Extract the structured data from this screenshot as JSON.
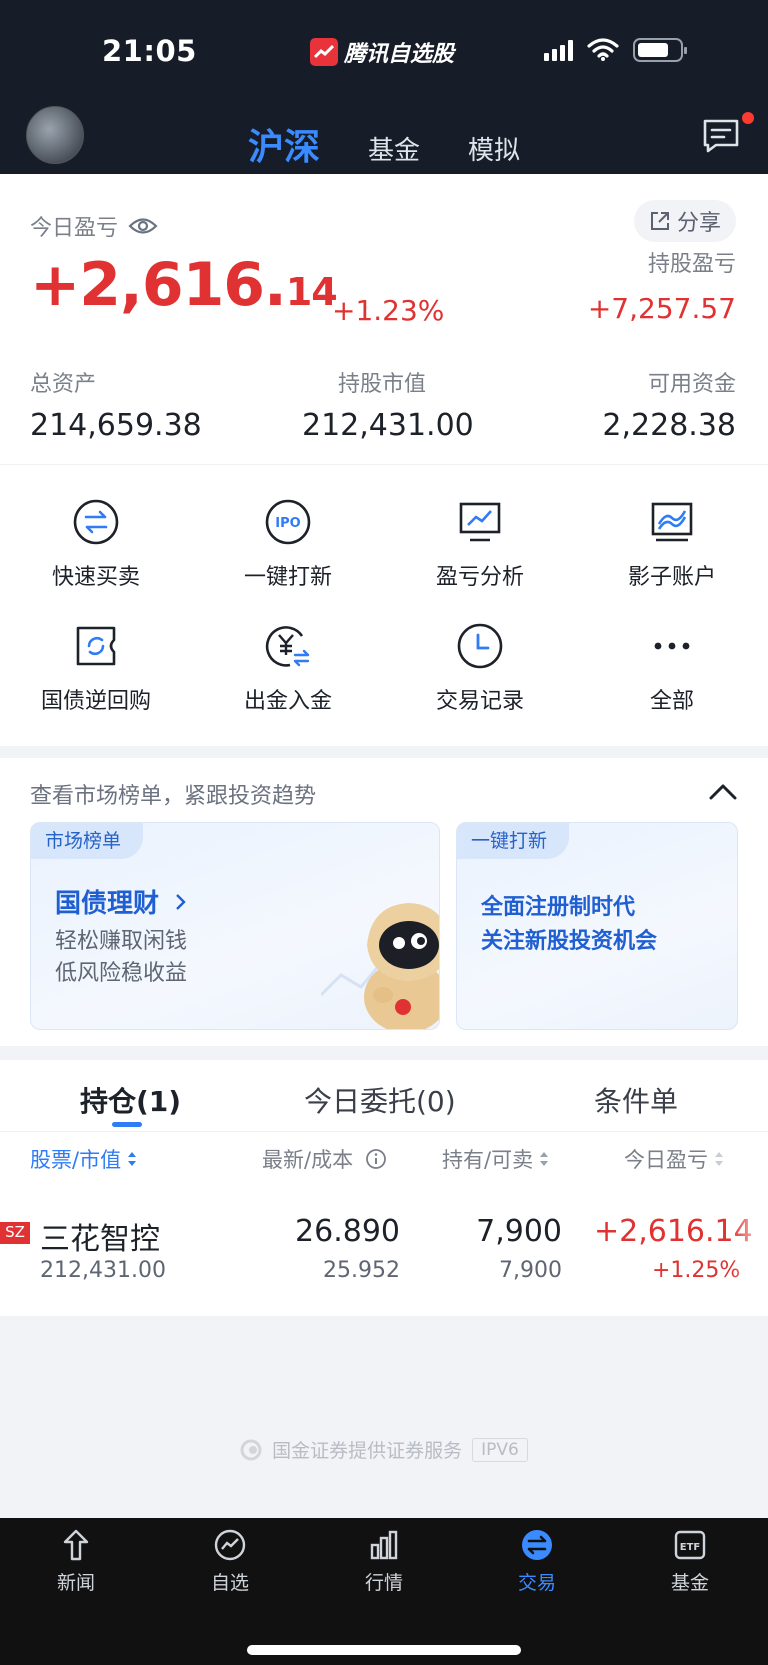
{
  "status_bar": {
    "time": "21:05",
    "app_name": "腾讯自选股"
  },
  "top_nav": {
    "tabs": [
      {
        "label": "沪深",
        "active": true
      },
      {
        "label": "基金",
        "active": false
      },
      {
        "label": "模拟",
        "active": false
      }
    ],
    "message_icon": "message-icon",
    "has_unread": true
  },
  "summary": {
    "today_pnl_label": "今日盈亏",
    "share_label": "分享",
    "today_pnl_int": "+2,616.",
    "today_pnl_dec": "14",
    "today_pnl_pct": "+1.23%",
    "holding_pnl_label": "持股盈亏",
    "holding_pnl_value": "+7,257.57",
    "total_assets_label": "总资产",
    "total_assets_value": "214,659.38",
    "market_value_label": "持股市值",
    "market_value_value": "212,431.00",
    "available_cash_label": "可用资金",
    "available_cash_value": "2,228.38"
  },
  "actions": [
    {
      "label": "快速买卖",
      "icon": "swap-icon"
    },
    {
      "label": "一键打新",
      "icon": "ipo-icon"
    },
    {
      "label": "盈亏分析",
      "icon": "chart-monitor-icon"
    },
    {
      "label": "影子账户",
      "icon": "shadow-account-icon"
    },
    {
      "label": "国债逆回购",
      "icon": "repo-icon"
    },
    {
      "label": "出金入金",
      "icon": "yuan-transfer-icon"
    },
    {
      "label": "交易记录",
      "icon": "clock-icon"
    },
    {
      "label": "全部",
      "icon": "more-icon"
    }
  ],
  "promo": {
    "title": "查看市场榜单，紧跟投资趋势",
    "card1": {
      "tag": "市场榜单",
      "headline": "国债理财",
      "line1": "轻松赚取闲钱",
      "line2": "低风险稳收益"
    },
    "card2": {
      "tag": "一键打新",
      "line1": "全面注册制时代",
      "line2": "关注新股投资机会"
    }
  },
  "positions": {
    "tabs": [
      {
        "label": "持仓(1)",
        "active": true
      },
      {
        "label": "今日委托(0)",
        "active": false
      },
      {
        "label": "条件单",
        "active": false
      }
    ],
    "columns": [
      "股票/市值",
      "最新/成本",
      "持有/可卖",
      "今日盈亏"
    ],
    "rows": [
      {
        "exchange": "SZ",
        "name": "三花智控",
        "market_value": "212,431.00",
        "latest": "26.890",
        "cost": "25.952",
        "holding": "7,900",
        "sellable": "7,900",
        "today_pnl": "+2,616.14",
        "today_pct": "+1.25%"
      }
    ]
  },
  "footer": {
    "note": "国金证券提供证券服务",
    "ipv6": "IPV6"
  },
  "bottom_nav": [
    {
      "label": "新闻",
      "icon": "news-icon",
      "active": false
    },
    {
      "label": "自选",
      "icon": "watchlist-icon",
      "active": false
    },
    {
      "label": "行情",
      "icon": "market-icon",
      "active": false
    },
    {
      "label": "交易",
      "icon": "trade-icon",
      "active": true
    },
    {
      "label": "基金",
      "icon": "etf-icon",
      "active": false
    }
  ],
  "colors": {
    "header_bg": "#161c28",
    "accent_blue": "#2f7cf6",
    "gain_red": "#e03232"
  }
}
